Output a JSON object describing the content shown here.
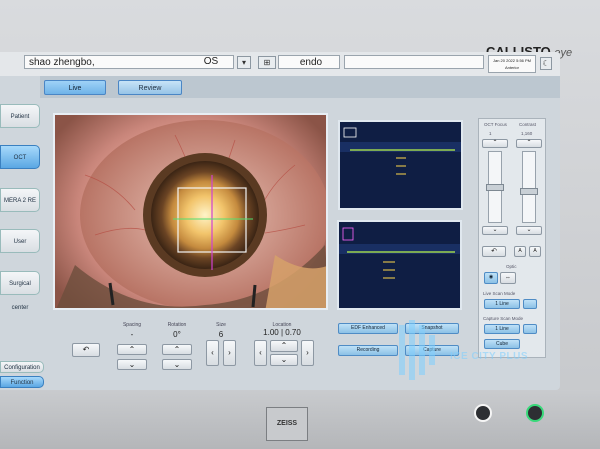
{
  "brand": {
    "name": "CALLISTO",
    "suffix": "eye"
  },
  "patient": {
    "name": "shao zhengbo,",
    "eye": "OS",
    "procedure": "endo"
  },
  "datebox": {
    "line1": "Jan 20 2022 5:56 PM",
    "line2": "Anterior"
  },
  "tabs": [
    {
      "label": "Live"
    },
    {
      "label": "Review"
    }
  ],
  "side_nav": {
    "patient": "Patient",
    "oct": "OCT",
    "mera": "MERA 2 RE",
    "user": "User",
    "planning": "Surgical center",
    "configuration": "Configuration",
    "function": "Function"
  },
  "controls": {
    "spacing_label": "Spacing",
    "spacing_value": "-",
    "rotation_label": "Rotation",
    "rotation_value": "0°",
    "size_label": "Size",
    "size_value": "6",
    "location_label": "Location",
    "location_value": "1.00 | 0.70"
  },
  "oct_buttons": {
    "focus_enhance": "EDF Enhanced",
    "recording": "Recording",
    "snapshot": "Snapshot",
    "capture": "Capture"
  },
  "right_panel": {
    "oct_focus_label": "OCT Focus",
    "contrast_label": "Contrast",
    "focus_value": "1",
    "contrast_value": "1,160",
    "optic_label": "Optic",
    "live_scan_mode_label": "Live Scan Mode",
    "live_scan_value": "1 Line",
    "capture_scan_mode_label": "Capture Scan Mode",
    "capture_value1": "1 Line",
    "capture_value2": "Cube"
  },
  "watermark": {
    "text": "ICE CITY PLUS"
  },
  "zeiss": {
    "text": "ZEISS"
  }
}
